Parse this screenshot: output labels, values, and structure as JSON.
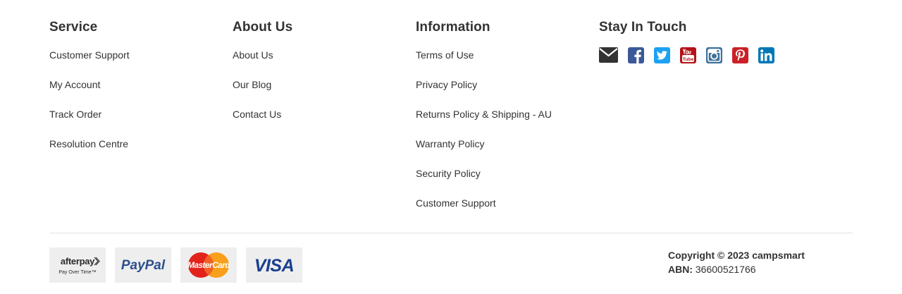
{
  "columns": [
    {
      "title": "Service",
      "links": [
        "Customer Support",
        "My Account",
        "Track Order",
        "Resolution Centre"
      ]
    },
    {
      "title": "About Us",
      "links": [
        "About Us",
        "Our Blog",
        "Contact Us"
      ]
    },
    {
      "title": "Information",
      "links": [
        "Terms of Use",
        "Privacy Policy",
        "Returns Policy & Shipping - AU",
        "Warranty Policy",
        "Security Policy",
        "Customer Support"
      ]
    }
  ],
  "stay_in_touch": {
    "title": "Stay In Touch",
    "icons": [
      "email-icon",
      "facebook-icon",
      "twitter-icon",
      "youtube-icon",
      "instagram-icon",
      "pinterest-icon",
      "linkedin-icon"
    ]
  },
  "payments": {
    "afterpay": {
      "name": "afterpay",
      "tagline": "Pay Over Time™"
    },
    "paypal": "PayPal",
    "mastercard": "MasterCard",
    "visa": "VISA"
  },
  "copyright": {
    "text": "Copyright © 2023 campsmart",
    "abn_label": "ABN:",
    "abn_value": "36600521766"
  },
  "colors": {
    "text": "#333333",
    "email_icon": "#333333",
    "facebook": "#3b5998",
    "twitter": "#1da1f2",
    "youtube": "#b31217",
    "instagram": "#3f729b",
    "pinterest": "#cb2027",
    "linkedin": "#0077b5",
    "payment_bg": "#eeeeee"
  }
}
